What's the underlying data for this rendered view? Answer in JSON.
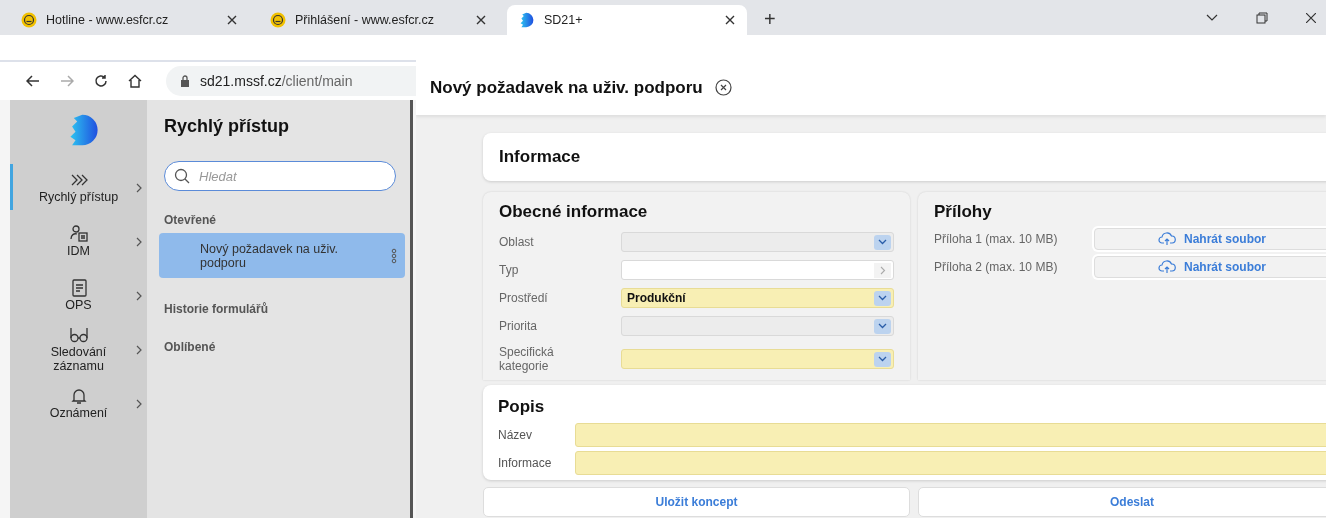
{
  "browser": {
    "tabs": [
      {
        "title": "Hotline - www.esfcr.cz",
        "kind": "esf",
        "selected": false
      },
      {
        "title": "Přihlášení - www.esfcr.cz",
        "kind": "esf",
        "selected": false
      },
      {
        "title": "SD21+",
        "kind": "app",
        "selected": true
      }
    ],
    "new_tab": "+",
    "address": {
      "host": "sd21.mssf.cz",
      "path": "/client/main"
    }
  },
  "nav": {
    "items": [
      {
        "label": "Rychlý přístup",
        "kind": "chevrons",
        "selected": true
      },
      {
        "label": "IDM",
        "kind": "person",
        "selected": false
      },
      {
        "label": "OPS",
        "kind": "document",
        "selected": false
      },
      {
        "label": "Sledování záznamu",
        "kind": "glasses",
        "selected": false
      },
      {
        "label": "Oznámení",
        "kind": "bell",
        "selected": false
      }
    ]
  },
  "quick_access": {
    "title": "Rychlý přístup",
    "search": {
      "placeholder": "Hledat"
    },
    "sections": [
      {
        "title": "Otevřené",
        "items": [
          {
            "label": "Nový požadavek na uživ. podporu",
            "selected": true
          }
        ]
      },
      {
        "title": "Historie formulářů"
      },
      {
        "title": "Oblíbené"
      }
    ]
  },
  "drawer": {
    "title": "Nový požadavek na uživ. podporu",
    "info_title": "Informace",
    "general": {
      "title": "Obecné informace",
      "fields": [
        {
          "label": "Oblast",
          "kind": "select",
          "required": false
        },
        {
          "label": "Typ",
          "kind": "lookup",
          "required": false
        },
        {
          "label": "Prostředí",
          "kind": "select",
          "required": true,
          "value": "Produkční"
        },
        {
          "label": "Priorita",
          "kind": "select",
          "required": false
        },
        {
          "label": "Specifická kategorie",
          "kind": "select",
          "required": true
        }
      ]
    },
    "attachments": {
      "title": "Přílohy",
      "items": [
        {
          "label": "Příloha 1 (max. 10 MB)",
          "button": "Nahrát soubor"
        },
        {
          "label": "Příloha 2 (max. 10 MB)",
          "button": "Nahrát soubor"
        }
      ]
    },
    "description": {
      "title": "Popis",
      "fields": [
        {
          "label": "Název",
          "required": true
        },
        {
          "label": "Informace",
          "required": true
        }
      ]
    },
    "buttons": [
      "Uložit koncept",
      "Odeslat"
    ]
  }
}
